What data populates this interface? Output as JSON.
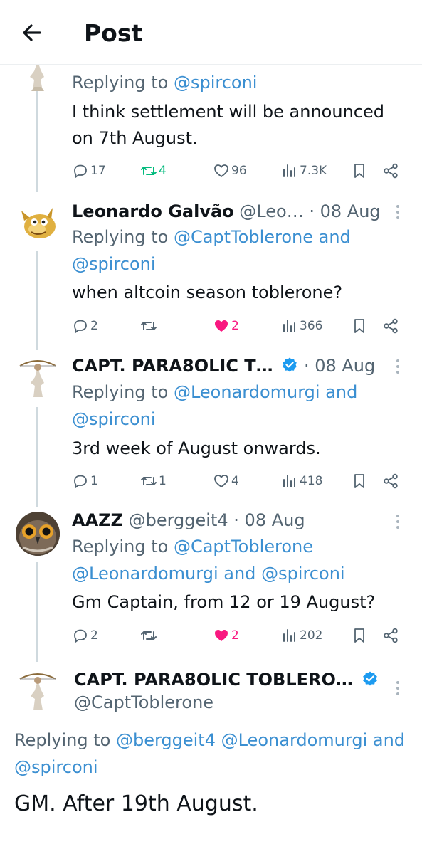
{
  "header": {
    "title": "Post"
  },
  "tweets": [
    {
      "replying_prefix": "Replying to",
      "mentions": "@spirconi",
      "text": "I think settlement will be announced on 7th August.",
      "replies": "17",
      "retweets": "4",
      "likes": "96",
      "views": "7.3K"
    },
    {
      "name": "Leonardo Galvão",
      "handle": "@Leo…",
      "dot": "·",
      "date": "08 Aug",
      "replying_prefix": "Replying to",
      "mentions_1": "@CaptToblerone",
      "and": "and",
      "mentions_2": "@spirconi",
      "text": "when altcoin season toblerone?",
      "replies": "2",
      "retweets": "",
      "likes": "2",
      "views": "366"
    },
    {
      "name": "CAPT. PARA8OLIC T…",
      "dot": "·",
      "date": "08 Aug",
      "replying_prefix": "Replying to",
      "mentions_1": "@Leonardomurgi",
      "and": "and",
      "mentions_2": "@spirconi",
      "text": "3rd week of August onwards.",
      "replies": "1",
      "retweets": "1",
      "likes": "4",
      "views": "418"
    },
    {
      "name": "AAZZ",
      "handle": "@berggeit4",
      "dot": "·",
      "date": "08 Aug",
      "replying_prefix": "Replying to",
      "mentions_1": "@CaptToblerone",
      "mentions_2": "@Leonardomurgi",
      "and": "and",
      "mentions_3": "@spirconi",
      "text": "Gm Captain, from 12 or 19 August?",
      "replies": "2",
      "retweets": "",
      "likes": "2",
      "views": "202"
    }
  ],
  "main_tweet": {
    "name": "CAPT. PARA8OLIC TOBLERO…",
    "handle": "@CaptToblerone",
    "replying_prefix": "Replying to",
    "mentions_1": "@berggeit4",
    "mentions_2": "@Leonardomurgi",
    "and": "and",
    "mentions_3": "@spirconi",
    "text": "GM. After 19th August."
  },
  "colors": {
    "link": "#3b8fd1",
    "retweet": "#00ba7c",
    "like": "#f91880",
    "verified": "#1d9bf0"
  }
}
